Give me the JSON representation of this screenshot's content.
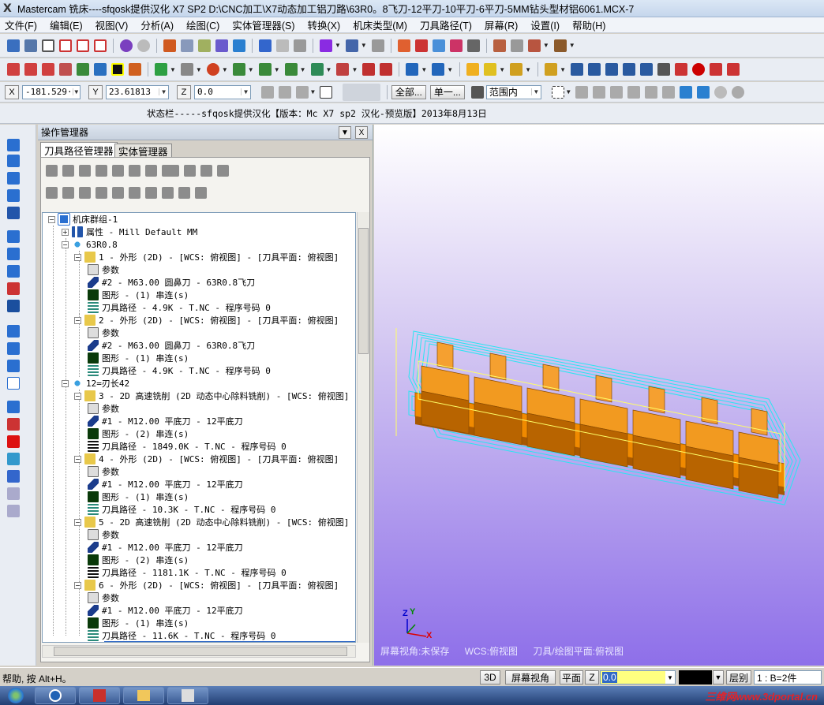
{
  "window": {
    "title": "Mastercam 铣床----sfqosk提供汉化 X7 SP2  D:\\CNC加工\\X7动态加工铝刀路\\63R0。8飞刀-12平刀-10平刀-6平刀-5MM钻头型材铝6061.MCX-7"
  },
  "menu": [
    "文件(F)",
    "编辑(E)",
    "视图(V)",
    "分析(A)",
    "绘图(C)",
    "实体管理器(S)",
    "转换(X)",
    "机床类型(M)",
    "刀具路径(T)",
    "屏幕(R)",
    "设置(I)",
    "帮助(H)"
  ],
  "coords": {
    "x_label": "X",
    "x_value": "-181.529·",
    "y_label": "Y",
    "y_value": "23.61813",
    "z_label": "Z",
    "z_value": "0.0",
    "all_btn": "全部...",
    "single_btn": "单一...",
    "range_value": "范围内"
  },
  "statusline": "状态栏-----sfqosk提供汉化【版本：Mc X7 sp2 汉化-预览版】2013年8月13日",
  "ops": {
    "title": "操作管理器",
    "close": "X",
    "tabs": [
      "刀具路径管理器",
      "实体管理器"
    ],
    "tree": [
      "机床群组-1",
      "属性 - Mill Default MM",
      "63R0.8",
      "1 - 外形 (2D) - [WCS: 俯视图] - [刀具平面: 俯视图]",
      "参数",
      "#2 - M63.00 圆鼻刀 - 63R0.8飞刀",
      "图形 - (1) 串连(s)",
      "刀具路径 - 4.9K - T.NC - 程序号码 0",
      "2 - 外形 (2D) - [WCS: 俯视图] - [刀具平面: 俯视图]",
      "参数",
      "#2 - M63.00 圆鼻刀 - 63R0.8飞刀",
      "图形 - (1) 串连(s)",
      "刀具路径 - 4.9K - T.NC - 程序号码 0",
      "12=刃长42",
      "3 - 2D 高速铣削 (2D 动态中心除料铣削) - [WCS: 俯视图]",
      "参数",
      "#1 - M12.00 平底刀 - 12平底刀",
      "图形 - (2) 串连(s)",
      "刀具路径 - 1849.0K - T.NC - 程序号码 0",
      "4 - 外形 (2D) - [WCS: 俯视图] - [刀具平面: 俯视图]",
      "参数",
      "#1 - M12.00 平底刀 - 12平底刀",
      "图形 - (1) 串连(s)",
      "刀具路径 - 10.3K - T.NC - 程序号码 0",
      "5 - 2D 高速铣削 (2D 动态中心除料铣削) - [WCS: 俯视图]",
      "参数",
      "#1 - M12.00 平底刀 - 12平底刀",
      "图形 - (2) 串连(s)",
      "刀具路径 - 1181.1K - T.NC - 程序号码 0",
      "6 - 外形 (2D) - [WCS: 俯视图] - [刀具平面: 俯视图]",
      "参数",
      "#1 - M12.00 平底刀 - 12平底刀",
      "图形 - (1) 串连(s)",
      "刀具路径 - 11.6K - T.NC - 程序号码 0"
    ]
  },
  "viewport": {
    "status": [
      "屏幕视角:未保存",
      "WCS:俯视图",
      "刀具/绘图平面:俯视图"
    ],
    "axis_x": "X",
    "axis_y": "Y",
    "axis_z": "Z"
  },
  "bottom": {
    "help": "帮助, 按 Alt+H。",
    "btn_3d": "3D",
    "btn_view": "屏幕视角",
    "btn_plane": "平面",
    "z_label": "Z",
    "z_value": "0.0",
    "layer_label": "层别",
    "layer_value": "1 : B=2件"
  },
  "watermark": "三维网www.3dportal.cn",
  "colors": {
    "stock": "#f08a00",
    "toolpath": "#27e6f2",
    "highlight": "#ffff66",
    "bg_top": "#ffffff",
    "bg_bottom": "#8e6fe9"
  }
}
